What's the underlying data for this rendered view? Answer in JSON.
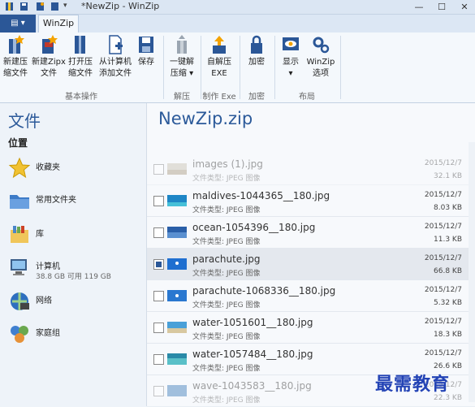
{
  "titlebar": {
    "title": "*NewZip - WinZip",
    "min": "—",
    "max": "☐",
    "close": "✕"
  },
  "tabs": {
    "file": "▤ ▾",
    "winzip": "WinZip"
  },
  "ribbon": {
    "groups": [
      {
        "label": "基本操作"
      },
      {
        "label": "解压"
      },
      {
        "label": "制作 Exe"
      },
      {
        "label": "加密"
      },
      {
        "label": "布局"
      }
    ],
    "buttons": [
      {
        "line1": "新建压",
        "line2": "缩文件"
      },
      {
        "line1": "新建Zipx",
        "line2": "文件"
      },
      {
        "line1": "打开压",
        "line2": "缩文件"
      },
      {
        "line1": "从计算机",
        "line2": "添加文件"
      },
      {
        "line1": "保存",
        "line2": ""
      },
      {
        "line1": "一键解",
        "line2": "压缩 ▾"
      },
      {
        "line1": "自解压",
        "line2": "EXE"
      },
      {
        "line1": "加密",
        "line2": ""
      },
      {
        "line1": "显示",
        "line2": "▾"
      },
      {
        "line1": "WinZip",
        "line2": "选项"
      }
    ]
  },
  "left": {
    "title": "文件",
    "subtitle": "位置",
    "items": [
      {
        "label": "收藏夹",
        "sub": ""
      },
      {
        "label": "常用文件夹",
        "sub": ""
      },
      {
        "label": "库",
        "sub": ""
      },
      {
        "label": "计算机",
        "sub": "38.8 GB 可用 119 GB"
      },
      {
        "label": "网络",
        "sub": ""
      },
      {
        "label": "家庭组",
        "sub": ""
      }
    ]
  },
  "right": {
    "title": "NewZip.zip",
    "files": [
      {
        "name": "images (1).jpg",
        "type": "文件类型: JPEG 图像",
        "date": "2015/12/7",
        "size": "32.1 KB",
        "checked": false
      },
      {
        "name": "maldives-1044365__180.jpg",
        "type": "文件类型: JPEG 图像",
        "date": "2015/12/7",
        "size": "8.03 KB",
        "checked": false
      },
      {
        "name": "ocean-1054396__180.jpg",
        "type": "文件类型: JPEG 图像",
        "date": "2015/12/7",
        "size": "11.3 KB",
        "checked": false
      },
      {
        "name": "parachute.jpg",
        "type": "文件类型: JPEG 图像",
        "date": "2015/12/7",
        "size": "66.8 KB",
        "checked": true
      },
      {
        "name": "parachute-1068336__180.jpg",
        "type": "文件类型: JPEG 图像",
        "date": "2015/12/7",
        "size": "5.32 KB",
        "checked": false
      },
      {
        "name": "water-1051601__180.jpg",
        "type": "文件类型: JPEG 图像",
        "date": "2015/12/7",
        "size": "18.3 KB",
        "checked": false
      },
      {
        "name": "water-1057484__180.jpg",
        "type": "文件类型: JPEG 图像",
        "date": "2015/12/7",
        "size": "26.6 KB",
        "checked": false
      },
      {
        "name": "wave-1043583__180.jpg",
        "type": "文件类型: JPEG 图像",
        "date": "2015/12/7",
        "size": "22.3 KB",
        "checked": false
      }
    ]
  },
  "watermark": "最需教育",
  "colors": {
    "accent": "#2c5a9a",
    "file_tab": "#2b5797"
  }
}
